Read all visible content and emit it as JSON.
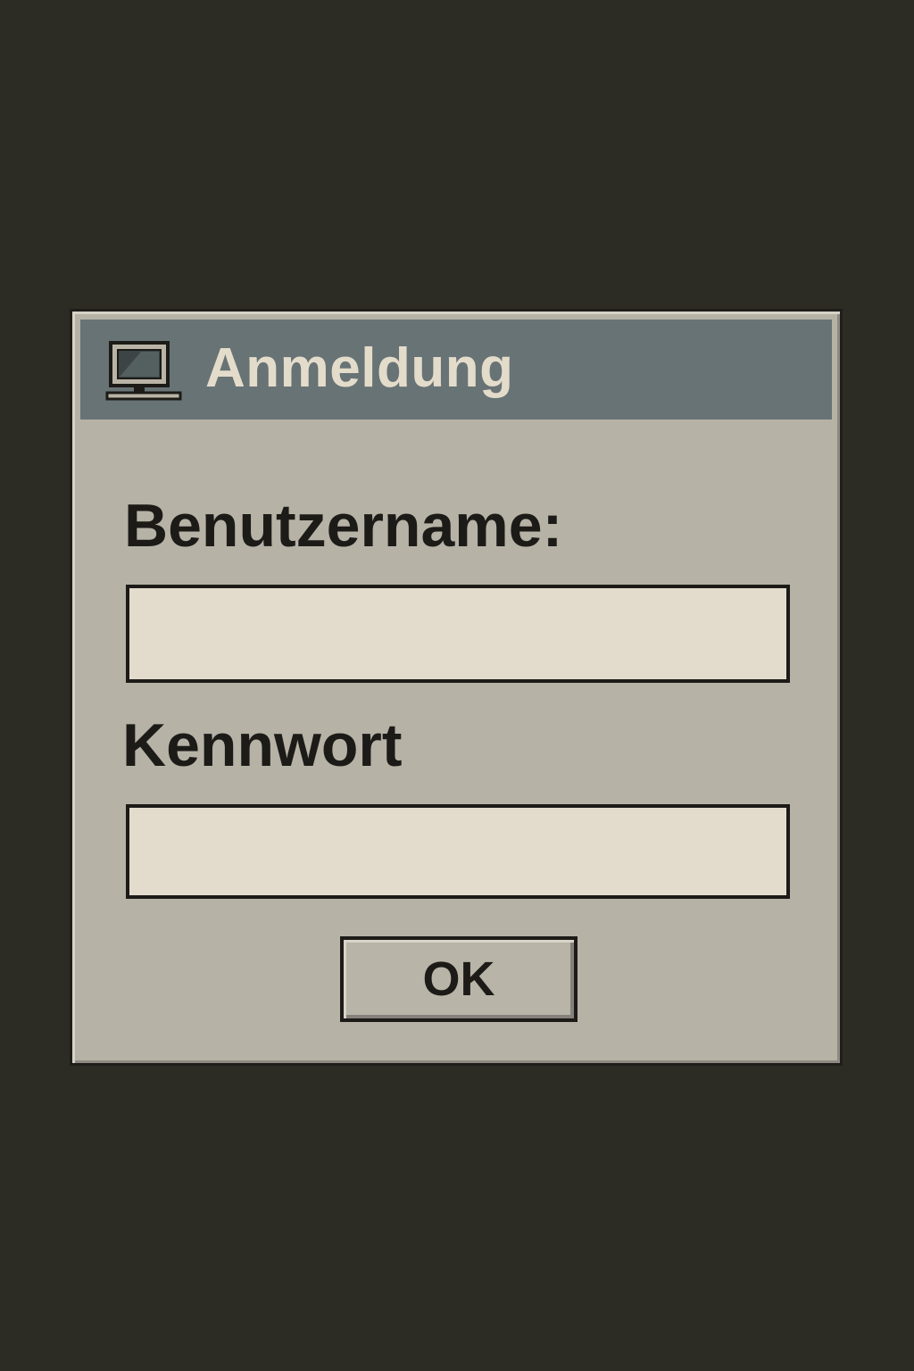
{
  "window": {
    "title": "Anmeldung",
    "icon": "computer-monitor-icon"
  },
  "form": {
    "username_label": "Benutzername:",
    "username_value": "",
    "password_label": "Kennwort",
    "password_value": "",
    "ok_label": "OK"
  },
  "colors": {
    "background": "#2c2b24",
    "dialog": "#b6b2a6",
    "titlebar": "#687375",
    "title_text": "#e4dccb",
    "field": "#e3dccd",
    "text": "#1c1b17"
  }
}
